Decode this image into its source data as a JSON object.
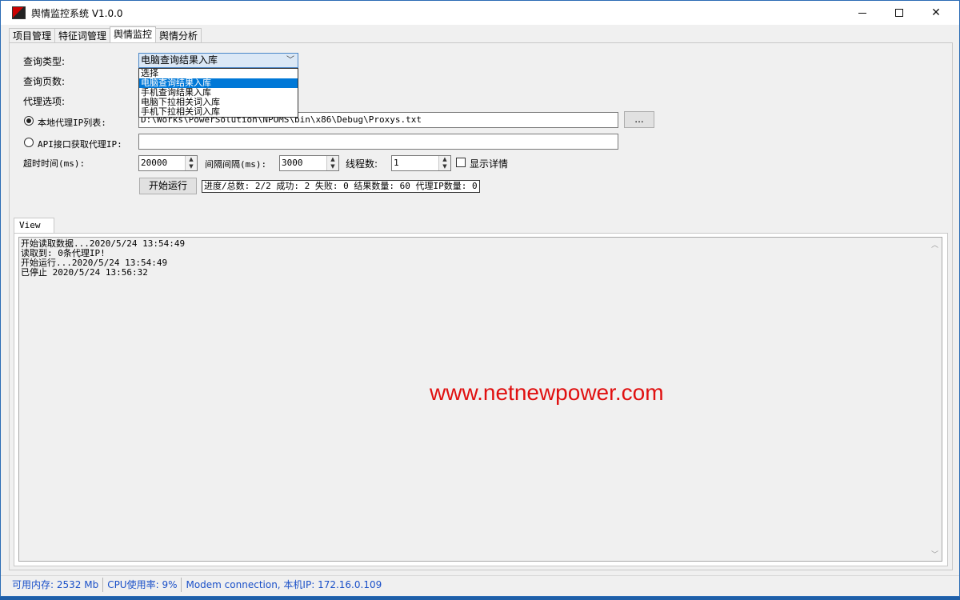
{
  "window": {
    "title": "舆情监控系统 V1.0.0",
    "icon": "app-logo-icon",
    "controls": [
      "minimize-icon",
      "maximize-icon",
      "close-icon"
    ]
  },
  "tabs": [
    {
      "label": "项目管理",
      "active": false
    },
    {
      "label": "特征词管理",
      "active": false
    },
    {
      "label": "舆情监控",
      "active": true
    },
    {
      "label": "舆情分析",
      "active": false
    }
  ],
  "form": {
    "query_type_label": "查询类型:",
    "query_type_value": "电脑查询结果入库",
    "query_type_options": [
      "选择",
      "电脑查询结果入库",
      "手机查询结果入库",
      "电脑下拉相关词入库",
      "手机下拉相关词入库"
    ],
    "query_type_selected_index": 1,
    "query_pages_label": "查询页数:",
    "proxy_options_label": "代理选项:",
    "local_proxy_label": "本地代理IP列表:",
    "local_proxy_path": "D:\\Works\\PowerSolution\\NPOMS\\bin\\x86\\Debug\\Proxys.txt",
    "browse_label": "...",
    "api_proxy_label": "API接口获取代理IP:",
    "api_proxy_value": "",
    "timeout_label": "超时时间(ms):",
    "timeout_value": "20000",
    "interval_label": "间隔间隔(ms):",
    "interval_value": "3000",
    "threads_label": "线程数:",
    "threads_value": "1",
    "show_details_label": "显示详情",
    "show_details_checked": false,
    "start_label": "开始运行",
    "progress_text": "进度/总数: 2/2 成功: 2 失败: 0 结果数量: 60 代理IP数量: 0"
  },
  "view": {
    "tab_label": "View",
    "log_lines": [
      "开始读取数据...2020/5/24 13:54:49",
      "读取到: 0条代理IP!",
      "开始运行...2020/5/24 13:54:49",
      "已停止 2020/5/24 13:56:32"
    ],
    "watermark": "www.netnewpower.com"
  },
  "statusbar": {
    "memory": "可用内存: 2532 Mb",
    "cpu": "CPU使用率: 9%",
    "network": "Modem connection, 本机IP: 172.16.0.109"
  },
  "colors": {
    "accent": "#0078d7",
    "watermark": "#e01010",
    "statusbar_text": "#1a50c8"
  }
}
